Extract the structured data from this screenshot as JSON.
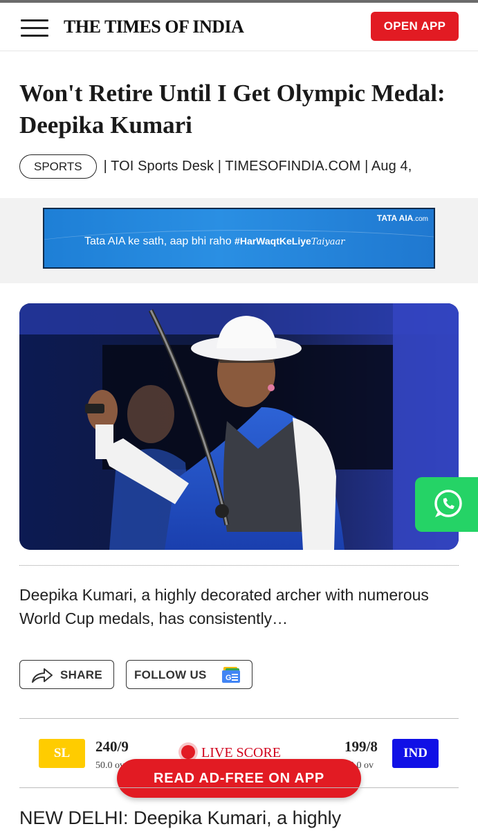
{
  "header": {
    "logo": "THE TIMES OF INDIA",
    "open_app_label": "OPEN APP"
  },
  "article": {
    "headline": "Won't Retire Until I Get Olympic Medal: Deepika Kumari",
    "category": "SPORTS",
    "byline": "| TOI Sports Desk | TIMESOFINDIA.COM | Aug 4,",
    "summary": "Deepika Kumari, a highly decorated archer with numerous World Cup medals, has consistently…",
    "body_start": "NEW DELHI: Deepika Kumari, a highly"
  },
  "ad": {
    "brand": "TATA AIA",
    "brand_suffix": ".com",
    "tagline": "Tata AIA ke sath, aap bhi raho",
    "hashtag": "#HarWaqtKeLiye",
    "script_word": "Taiyaar"
  },
  "actions": {
    "share_label": "SHARE",
    "follow_label": "FOLLOW US"
  },
  "live_score": {
    "label": "LIVE SCORE",
    "team1": {
      "code": "SL",
      "score": "240/9",
      "overs": "50.0 ov"
    },
    "team2": {
      "code": "IND",
      "score": "199/8",
      "overs": "40.0 ov"
    }
  },
  "cta": {
    "read_ad_free": "READ AD-FREE ON APP"
  },
  "colors": {
    "accent_red": "#e21b23",
    "whatsapp_green": "#25d366",
    "sl_badge": "#ffcc00",
    "ind_badge": "#1010e6"
  }
}
